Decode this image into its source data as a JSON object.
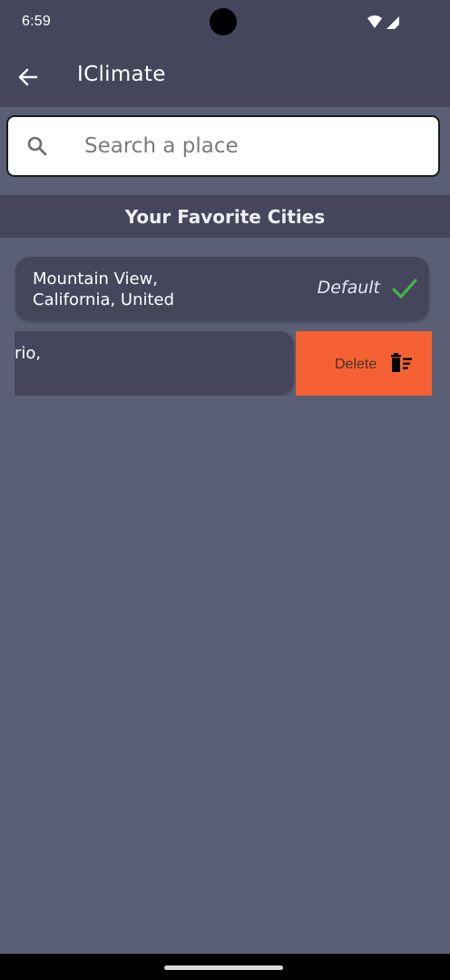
{
  "status_bar": {
    "time": "6:59"
  },
  "app_bar": {
    "title": "IClimate",
    "back_icon": "arrow-left-icon"
  },
  "search": {
    "placeholder": "Search a place",
    "value": "",
    "icon": "search-icon"
  },
  "favorites": {
    "header": "Your Favorite Cities",
    "items": [
      {
        "name": "Mountain View,\nCalifornia, United",
        "default_label": "Default",
        "is_default": true
      },
      {
        "name_visible": "rio,",
        "delete_label": "Delete",
        "swiped": true
      }
    ]
  },
  "colors": {
    "background": "#5b5f76",
    "bar": "#45465c",
    "card": "#45465c",
    "delete_accent": "#f56132",
    "check": "#4caf50"
  }
}
